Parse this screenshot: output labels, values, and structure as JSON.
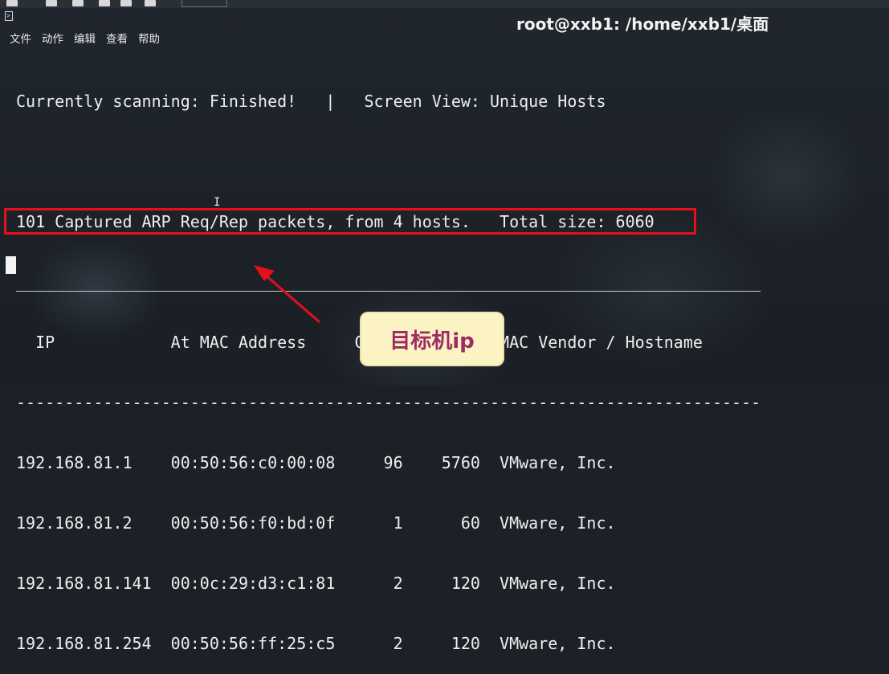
{
  "window": {
    "title": "root@xxb1: /home/xxb1/桌面"
  },
  "menu": [
    {
      "label": "文件"
    },
    {
      "label": "动作"
    },
    {
      "label": "编辑"
    },
    {
      "label": "查看"
    },
    {
      "label": "帮助"
    }
  ],
  "terminal": {
    "status_line": "Currently scanning: Finished!   |   Screen View: Unique Hosts",
    "summary_line": "101 Captured ARP Req/Rep packets, from 4 hosts.   Total size: 6060",
    "separator": "_____________________________________________________________________________",
    "header_line": "  IP            At MAC Address     Count     Len  MAC Vendor / Hostname",
    "dash_line": "-----------------------------------------------------------------------------",
    "rows": [
      "192.168.81.1    00:50:56:c0:00:08     96    5760  VMware, Inc.",
      "192.168.81.2    00:50:56:f0:bd:0f      1      60  VMware, Inc.",
      "192.168.81.141  00:0c:29:d3:c1:81      2     120  VMware, Inc.",
      "192.168.81.254  00:50:56:ff:25:c5      2     120  VMware, Inc."
    ]
  },
  "annotation": {
    "label": "目标机ip",
    "box_color": "#e5101a",
    "callout_bg": "#fbf3c4",
    "callout_text_color": "#9e2a64"
  }
}
